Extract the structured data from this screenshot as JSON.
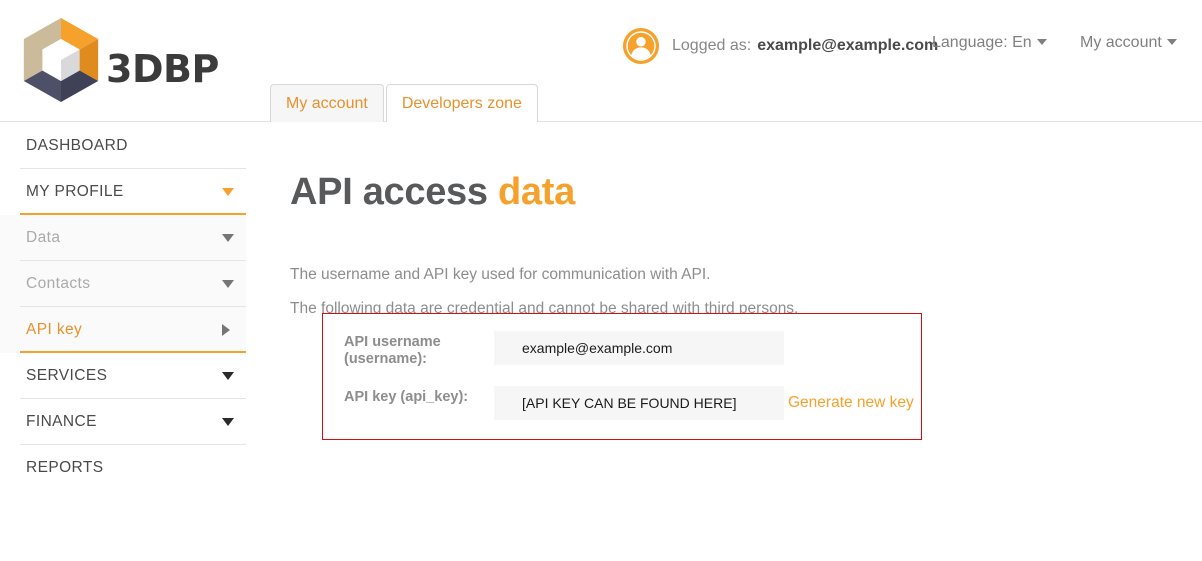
{
  "header": {
    "brand_name": "3DBP",
    "logo_icon": "cube-hexagon-logo",
    "avatar_icon": "user-avatar-icon",
    "logged_label": "Logged as:",
    "logged_email": "example@example.com",
    "language_label": "Language: En",
    "account_menu_label": "My account",
    "caret_icon": "chevron-down-icon"
  },
  "tabs": [
    {
      "label": "My account",
      "active": true
    },
    {
      "label": "Developers zone",
      "active": false
    }
  ],
  "sidebar": {
    "items": [
      {
        "label": "DASHBOARD",
        "level": "top",
        "arrow": "none",
        "rule": "plain",
        "active": false
      },
      {
        "label": "MY PROFILE",
        "level": "top",
        "arrow": "down-orange",
        "rule": "highlight",
        "active": false
      },
      {
        "label": "Data",
        "level": "sub",
        "arrow": "down-grey",
        "rule": "plain",
        "active": false
      },
      {
        "label": "Contacts",
        "level": "sub",
        "arrow": "down-grey",
        "rule": "plain",
        "active": false
      },
      {
        "label": "API key",
        "level": "sub",
        "arrow": "right-grey",
        "rule": "highlight",
        "active": true
      },
      {
        "label": "SERVICES",
        "level": "top",
        "arrow": "down-dark",
        "rule": "plain",
        "active": false
      },
      {
        "label": "FINANCE",
        "level": "top",
        "arrow": "down-dark",
        "rule": "plain",
        "active": false
      },
      {
        "label": "REPORTS",
        "level": "top",
        "arrow": "none",
        "rule": "none",
        "active": false
      }
    ]
  },
  "main": {
    "title_main": "API access",
    "title_accent": "data",
    "paragraph_1": "The username and API key used for communication with API.",
    "paragraph_2": "The following data are credential and cannot be shared with third persons.",
    "credentials": {
      "border_color": "#cc1111",
      "username_label_line1": "API username",
      "username_label_line2": "(username):",
      "username_value": "example@example.com",
      "apikey_label": "API key (api_key):",
      "apikey_value": "[API KEY CAN BE FOUND HERE]",
      "generate_link": "Generate new key"
    }
  },
  "colors": {
    "accent_orange": "#f5a12c",
    "tab_orange": "#e8912d",
    "alert_red": "#cc1111",
    "text_grey": "#8d8d8d",
    "text_dark": "#4a4a4a"
  }
}
